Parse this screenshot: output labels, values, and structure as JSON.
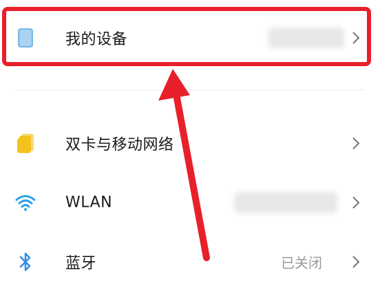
{
  "settings": {
    "items": [
      {
        "label": "我的设备",
        "value": "",
        "icon": "device-icon"
      },
      {
        "label": "双卡与移动网络",
        "value": "",
        "icon": "sim-card-icon"
      },
      {
        "label": "WLAN",
        "value": "",
        "icon": "wifi-icon"
      },
      {
        "label": "蓝牙",
        "value": "已关闭",
        "icon": "bluetooth-icon"
      }
    ]
  },
  "annotation": {
    "box_color": "#e8202a",
    "arrow_color": "#e8202a"
  },
  "colors": {
    "device_icon": "#a9d3f2",
    "sim_icon": "#f4c21d",
    "wifi_icon": "#2fa2e6",
    "bluetooth_icon": "#2f8de0"
  }
}
